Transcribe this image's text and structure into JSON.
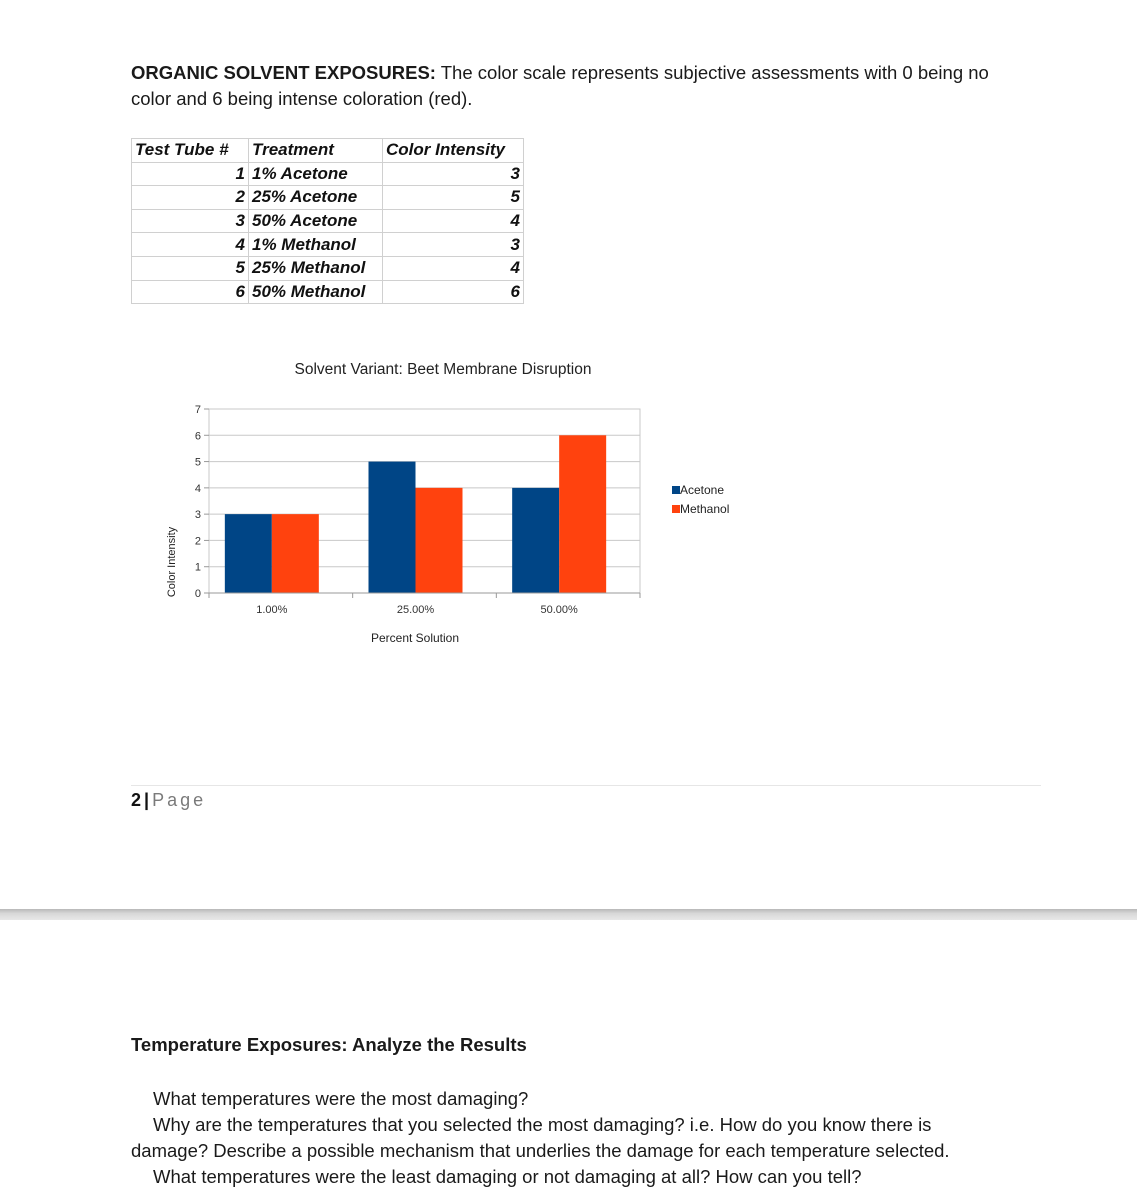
{
  "intro": {
    "heading": "ORGANIC SOLVENT EXPOSURES:",
    "text": " The color scale represents subjective assessments with 0 being no color and 6 being intense coloration (red)."
  },
  "table": {
    "headers": [
      "Test Tube #",
      "Treatment",
      "Color Intensity"
    ],
    "rows": [
      {
        "tube": "1",
        "treatment": "1% Acetone",
        "intensity": "3"
      },
      {
        "tube": "2",
        "treatment": "25% Acetone",
        "intensity": "5"
      },
      {
        "tube": "3",
        "treatment": "50% Acetone",
        "intensity": "4"
      },
      {
        "tube": "4",
        "treatment": "1% Methanol",
        "intensity": "3"
      },
      {
        "tube": "5",
        "treatment": "25% Methanol",
        "intensity": "4"
      },
      {
        "tube": "6",
        "treatment": "50% Methanol",
        "intensity": "6"
      }
    ]
  },
  "chart_data": {
    "type": "bar",
    "title": "Solvent Variant: Beet Membrane Disruption",
    "xlabel": "Percent Solution",
    "ylabel": "Color Intensity",
    "categories": [
      "1.00%",
      "25.00%",
      "50.00%"
    ],
    "series": [
      {
        "name": "Acetone",
        "color": "#004586",
        "values": [
          3,
          5,
          4
        ]
      },
      {
        "name": "Methanol",
        "color": "#ff420e",
        "values": [
          3,
          4,
          6
        ]
      }
    ],
    "ylim": [
      0,
      7
    ],
    "yticks": [
      0,
      1,
      2,
      3,
      4,
      5,
      6,
      7
    ],
    "grid": true,
    "legend": "right"
  },
  "footer": {
    "page_number": "2",
    "separator": "|",
    "page_label": "Page"
  },
  "section2": {
    "title": "Temperature Exposures: Analyze the Results",
    "questions": [
      "What temperatures were the most damaging?",
      "Why are the temperatures that you selected the most damaging? i.e. How do you know there is damage? Describe a possible mechanism that underlies the damage for each temperature selected.",
      "What temperatures were the least damaging or not damaging at all? How can you tell?"
    ]
  }
}
